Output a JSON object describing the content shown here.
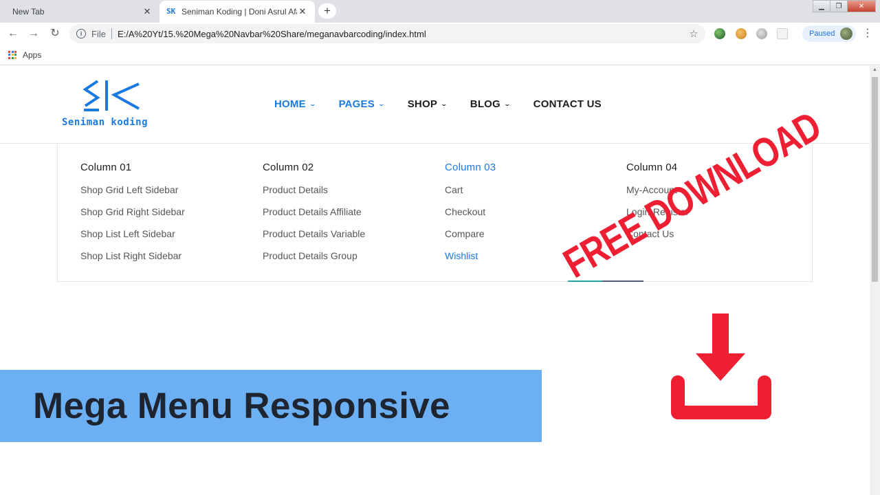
{
  "browser": {
    "tabs": [
      {
        "title": "New Tab",
        "active": false
      },
      {
        "title": "Seniman Koding | Doni Asrul Afa",
        "active": true
      }
    ],
    "favicon_text": "SK",
    "address_scheme_label": "File",
    "url": "E:/A%20Yt/15.%20Mega%20Navbar%20Share/meganavbarcoding/index.html",
    "profile_label": "Paused",
    "bookmarks": [
      {
        "label": "Apps"
      }
    ],
    "icons": {
      "back": "back-arrow-icon",
      "forward": "forward-arrow-icon",
      "reload": "reload-icon",
      "info": "info-icon",
      "star": "bookmark-star-icon",
      "menu": "kebab-menu-icon"
    }
  },
  "site": {
    "logo_text": "Seniman koding",
    "brand_color": "#1b7ae0",
    "nav": [
      {
        "label": "HOME",
        "active": true,
        "dropdown": true
      },
      {
        "label": "PAGES",
        "active": true,
        "dropdown": true
      },
      {
        "label": "SHOP",
        "active": false,
        "dropdown": true
      },
      {
        "label": "BLOG",
        "active": false,
        "dropdown": true
      },
      {
        "label": "CONTACT US",
        "active": false,
        "dropdown": false
      }
    ],
    "mega_menu": {
      "columns": [
        {
          "title": "Column 01",
          "active": false,
          "items": [
            "Shop Grid Left Sidebar",
            "Shop Grid Right Sidebar",
            "Shop List Left Sidebar",
            "Shop List Right Sidebar"
          ]
        },
        {
          "title": "Column 02",
          "active": false,
          "items": [
            "Product Details",
            "Product Details Affiliate",
            "Product Details Variable",
            "Product Details Group"
          ]
        },
        {
          "title": "Column 03",
          "active": true,
          "items": [
            "Cart",
            "Checkout",
            "Compare",
            "Wishlist"
          ],
          "active_item": "Wishlist"
        },
        {
          "title": "Column 04",
          "active": false,
          "items": [
            "My-Account",
            "Login-Register",
            "Contact Us"
          ]
        }
      ]
    }
  },
  "overlay": {
    "banner_text": "Mega Menu Responsive",
    "banner_color": "#6cb0f3",
    "free_download_text": "FREE DOWNLOAD",
    "free_download_color": "#ee1f33"
  }
}
